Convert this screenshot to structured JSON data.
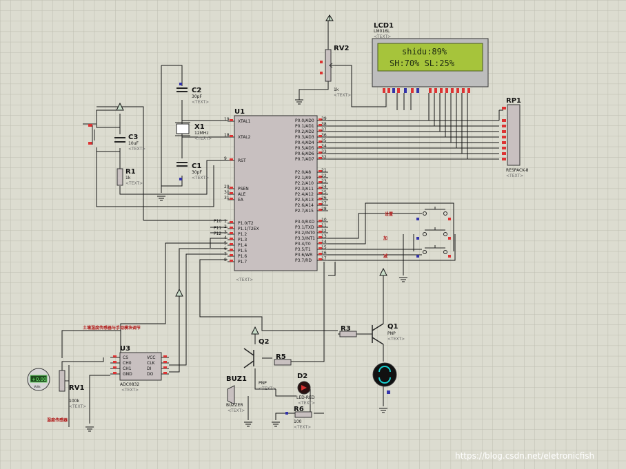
{
  "lcd": {
    "ref": "LCD1",
    "model": "LM016L",
    "line1": "shidu:89%",
    "line2": "SH:70%  SL:25%"
  },
  "components": {
    "u1": "U1",
    "u3": "U3",
    "u3_part": "ADC0832",
    "rv1": "RV1",
    "rv1_value": "100k",
    "rv2": "RV2",
    "rv2_value": "1k",
    "x1": "X1",
    "x1_value": "12MHz",
    "c1": "C1",
    "c1_value": "30pF",
    "c2": "C2",
    "c2_value": "30pF",
    "c3": "C3",
    "c3_value": "10uF",
    "r1": "R1",
    "r1_value": "1k",
    "rp1": "RP1",
    "rp1_part": "RESPACK-8",
    "r3": "R3",
    "r5": "R5",
    "r6": "R6",
    "r6_value": "100",
    "q1": "Q1",
    "q1_type": "PNP",
    "q2": "Q2",
    "q2_type": "PNP",
    "buz1": "BUZ1",
    "buz1_part": "BUZZER",
    "d2": "D2",
    "d2_part": "LED-RED",
    "text_placeholder": "<TEXT>",
    "meter_value": "+0.00",
    "meter_unit": "Volts"
  },
  "u1_left_pins": [
    "XTAL1",
    "XTAL2",
    "RST",
    "PSEN",
    "ALE",
    "EA",
    "P1.0/T2",
    "P1.1/T2EX",
    "P1.2",
    "P1.3",
    "P1.4",
    "P1.5",
    "P1.6",
    "P1.7"
  ],
  "u1_left_nums": [
    "19",
    "18",
    "9",
    "29",
    "30",
    "31",
    "1",
    "2",
    "3",
    "4",
    "5",
    "6",
    "7",
    "8"
  ],
  "u1_right_pins": [
    "P0.0/AD0",
    "P0.1/AD1",
    "P0.2/AD2",
    "P0.3/AD3",
    "P0.4/AD4",
    "P0.5/AD5",
    "P0.6/AD6",
    "P0.7/AD7",
    "P2.0/A8",
    "P2.1/A9",
    "P2.2/A10",
    "P2.3/A11",
    "P2.4/A12",
    "P2.5/A13",
    "P2.6/A14",
    "P2.7/A15",
    "P3.0/RXD",
    "P3.1/TXD",
    "P3.2/INT0",
    "P3.3/INT1",
    "P3.4/T0",
    "P3.5/T1",
    "P3.6/WR",
    "P3.7/RD"
  ],
  "u1_right_nums": [
    "39",
    "38",
    "37",
    "36",
    "35",
    "34",
    "33",
    "32",
    "21",
    "22",
    "23",
    "24",
    "25",
    "26",
    "27",
    "28",
    "10",
    "11",
    "12",
    "13",
    "14",
    "15",
    "16",
    "17"
  ],
  "net_labels": {
    "p10": "P10",
    "p11": "P11",
    "p12": "P12"
  },
  "u3_left_pins": [
    "CS",
    "CH0",
    "CH1",
    "GND"
  ],
  "u3_right_pins": [
    "VCC",
    "CLK",
    "DI",
    "DO"
  ],
  "annotations": {
    "sensor_title": "土壤湿度传感器与手动模块调节",
    "sensor_sub": "湿度传感器",
    "key_set": "设置",
    "key_plus": "加",
    "key_minus": "减"
  },
  "watermark": "https://blog.csdn.net/eletronicfish"
}
